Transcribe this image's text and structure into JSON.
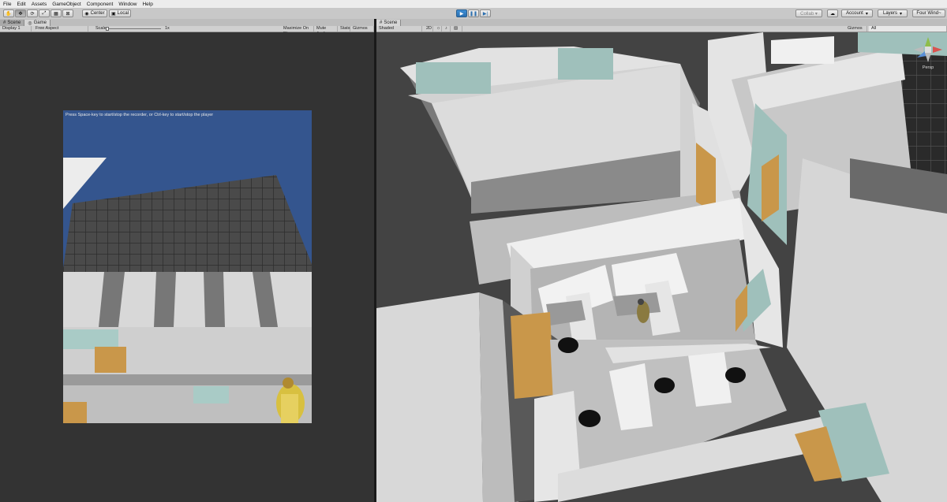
{
  "menu": [
    "File",
    "Edit",
    "Assets",
    "GameObject",
    "Component",
    "Window",
    "Help"
  ],
  "toolbar": {
    "pivot_label": "Center",
    "space_label": "Local",
    "collab_label": "Collab ▾",
    "account_label": "Account",
    "layers_label": "Layers",
    "layout_label": "Four Wind~"
  },
  "game_tabs": [
    "Scene",
    "Game"
  ],
  "game_bar": {
    "display": "Display 1",
    "aspect": "Free Aspect",
    "scale_label": "Scale",
    "scale_value": "1x",
    "maximize": "Maximize On Play",
    "mute": "Mute Audio",
    "stats": "Stats",
    "gizmos": "Gizmos"
  },
  "game_message": "Press Space-key to start/stop the recorder, or Ctrl-key to start/stop the player",
  "scene_tabs": [
    "Scene"
  ],
  "scene_bar": {
    "shading": "Shaded",
    "mode_2d": "2D",
    "gizmos": "Gizmos",
    "search": "All"
  },
  "gizmo": {
    "axis_label": "Persp"
  },
  "colors": {
    "menu_bg": "#ececec",
    "toolbar_bg": "#c8c8c8",
    "play_accent": "#2f80c8",
    "sky": "#34558e",
    "glass": "#8cb4ae",
    "wood": "#c9974a"
  }
}
